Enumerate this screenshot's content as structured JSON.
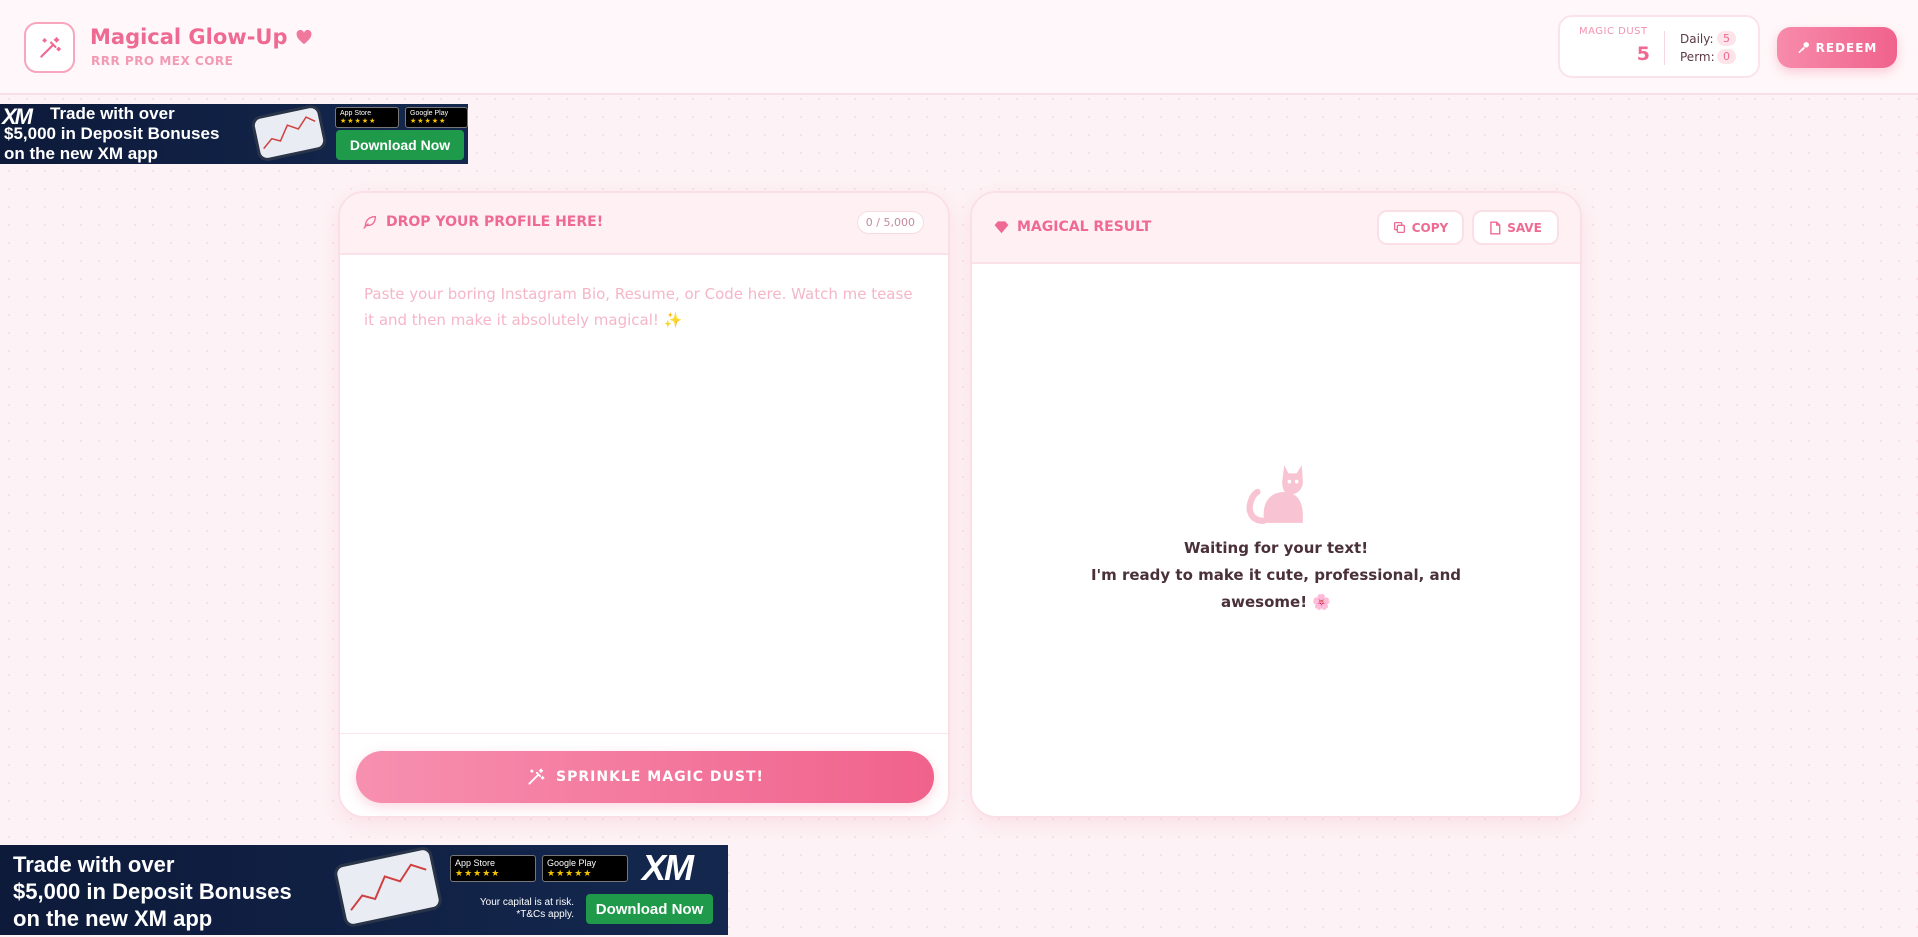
{
  "header": {
    "title": "Magical Glow-Up",
    "subtitle": "RRR PRO MEX CORE",
    "dust": {
      "label": "MAGIC DUST",
      "value": "5",
      "daily_label": "Daily:",
      "daily_value": "5",
      "perm_label": "Perm:",
      "perm_value": "0"
    },
    "redeem_label": "REDEEM"
  },
  "ad_top": {
    "brand": "XM",
    "headline_1": "Trade with over",
    "headline_2": "$5,000 in Deposit Bonuses",
    "headline_3": "on the new XM app",
    "app_store": "App Store",
    "google_play": "Google Play",
    "cta": "Download Now"
  },
  "ad_bottom": {
    "brand": "XM",
    "headline_1": "Trade with over",
    "headline_2": "$5,000 in Deposit Bonuses",
    "headline_3": "on the new XM app",
    "app_store": "App Store",
    "google_play": "Google Play",
    "disclaimer_1": "Your capital is at risk.",
    "disclaimer_2": "*T&Cs apply.",
    "cta": "Download Now"
  },
  "input_panel": {
    "title": "DROP YOUR PROFILE HERE!",
    "counter": "0 / 5,000",
    "placeholder": "Paste your boring Instagram Bio, Resume, or Code here. Watch me tease it and then make it absolutely magical! ✨",
    "value": "",
    "action_label": "SPRINKLE MAGIC DUST!"
  },
  "result_panel": {
    "title": "MAGICAL RESULT",
    "copy_label": "COPY",
    "save_label": "SAVE",
    "empty_line_1": "Waiting for your text!",
    "empty_line_2": "I'm ready to make it cute, professional, and",
    "empty_line_3": "awesome! 🌸"
  },
  "colors": {
    "accent": "#ee6a92",
    "accent_light": "#f790b0",
    "background": "#fdf2f5",
    "ad_background": "#0d1a3a",
    "ad_cta": "#1f9a4b"
  },
  "icons": {
    "logo": "magic-wand-icon",
    "title": "heart-icon",
    "redeem": "key-icon",
    "input_title": "feather-icon",
    "result_title": "gem-icon",
    "copy": "copy-icon",
    "save": "file-icon",
    "sprinkle": "magic-wand-icon",
    "empty_state": "cat-icon"
  }
}
